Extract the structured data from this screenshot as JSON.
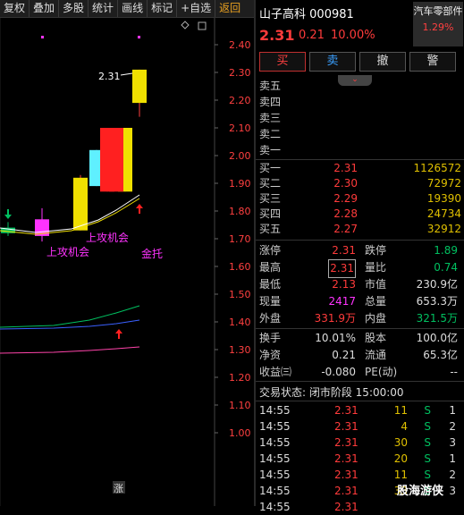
{
  "toolbar": [
    "复权",
    "叠加",
    "多股",
    "统计",
    "画线",
    "标记",
    "+自选",
    "返回"
  ],
  "stock": {
    "name": "山子高科",
    "code": "000981",
    "price": "2.31",
    "change": "0.21",
    "change_pct": "10.00%"
  },
  "sector": {
    "name": "汽车零部件",
    "pct": "1.29%"
  },
  "buttons": {
    "buy": "买",
    "sell": "卖",
    "cancel": "撤",
    "warn": "警"
  },
  "asks": [
    {
      "label": "卖五",
      "price": "",
      "vol": ""
    },
    {
      "label": "卖四",
      "price": "",
      "vol": ""
    },
    {
      "label": "卖三",
      "price": "",
      "vol": ""
    },
    {
      "label": "卖二",
      "price": "",
      "vol": ""
    },
    {
      "label": "卖一",
      "price": "",
      "vol": ""
    }
  ],
  "bids": [
    {
      "label": "买一",
      "price": "2.31",
      "vol": "1126572"
    },
    {
      "label": "买二",
      "price": "2.30",
      "vol": "72972"
    },
    {
      "label": "买三",
      "price": "2.29",
      "vol": "19390"
    },
    {
      "label": "买四",
      "price": "2.28",
      "vol": "24734"
    },
    {
      "label": "买五",
      "price": "2.27",
      "vol": "32912"
    }
  ],
  "quote": {
    "limit_up_l": "涨停",
    "limit_up": "2.31",
    "limit_down_l": "跌停",
    "limit_down": "1.89",
    "high_l": "最高",
    "high": "2.31",
    "vol_ratio_l": "量比",
    "vol_ratio": "0.74",
    "low_l": "最低",
    "low": "2.13",
    "mktcap_l": "市值",
    "mktcap": "230.9亿",
    "cur_vol_l": "现量",
    "cur_vol": "2417",
    "total_vol_l": "总量",
    "total_vol": "653.3万",
    "outer_l": "外盘",
    "outer": "331.9万",
    "inner_l": "内盘",
    "inner": "321.5万",
    "turnover_l": "换手",
    "turnover": "10.01%",
    "share_l": "股本",
    "share": "100.0亿",
    "nav_l": "净资",
    "nav": "0.21",
    "float_l": "流通",
    "float": "65.3亿",
    "eps_l": "收益㈢",
    "eps": "-0.080",
    "pe_l": "PE(动)",
    "pe": "--"
  },
  "trade_status": "交易状态: 闭市阶段 15:00:00",
  "trades": [
    {
      "t": "14:55",
      "p": "2.31",
      "v": "11",
      "s": "S",
      "n": "1"
    },
    {
      "t": "14:55",
      "p": "2.31",
      "v": "4",
      "s": "S",
      "n": "2"
    },
    {
      "t": "14:55",
      "p": "2.31",
      "v": "30",
      "s": "S",
      "n": "3"
    },
    {
      "t": "14:55",
      "p": "2.31",
      "v": "20",
      "s": "S",
      "n": "1"
    },
    {
      "t": "14:55",
      "p": "2.31",
      "v": "11",
      "s": "S",
      "n": "2"
    },
    {
      "t": "14:55",
      "p": "2.31",
      "v": "33",
      "s": "S",
      "n": "3"
    },
    {
      "t": "14:55",
      "p": "2.31",
      "v": "",
      "s": "",
      "n": ""
    }
  ],
  "chart": {
    "y_labels": [
      "2.40",
      "2.30",
      "2.20",
      "2.10",
      "2.00",
      "1.90",
      "1.80",
      "1.70",
      "1.60",
      "1.50",
      "1.40",
      "1.30",
      "1.20",
      "1.10",
      "1.00"
    ],
    "last_price_label": "2.31",
    "annotations": [
      "上攻机会",
      "上攻机会",
      "金托",
      "涨"
    ]
  },
  "watermark": "股海游侠",
  "colors": {
    "up": "#ff3b3b",
    "down": "#00c060",
    "yellow": "#f0e000",
    "bg": "#000000"
  }
}
